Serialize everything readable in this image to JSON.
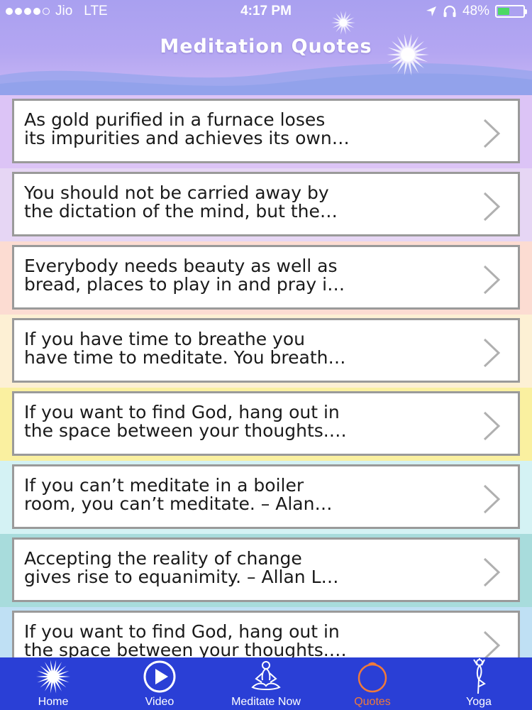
{
  "status_bar": {
    "carrier": "Jio",
    "network": "LTE",
    "time": "4:17 PM",
    "battery": "48%",
    "battery_level": 0.48
  },
  "header": {
    "title": "Meditation Quotes"
  },
  "quotes": [
    {
      "line1": "As gold purified in a furnace loses",
      "line2": "its impurities and achieves its own…",
      "bg": "#dcc4f6"
    },
    {
      "line1": "You should not be carried away by",
      "line2": "the dictation of the mind, but the…",
      "bg": "#e6d6f4"
    },
    {
      "line1": "Everybody needs beauty as well as",
      "line2": "bread, places to play in and pray i…",
      "bg": "#fcdcd2"
    },
    {
      "line1": "If you have time to breathe you",
      "line2": "have time to meditate. You breath…",
      "bg": "#fdf0d4"
    },
    {
      "line1": "If you want to find God, hang out in",
      "line2": "the space between your thoughts.…",
      "bg": "#faf0a0"
    },
    {
      "line1": "If you can’t meditate in a boiler",
      "line2": "room, you can’t meditate. – Alan…",
      "bg": "#d4f2f4"
    },
    {
      "line1": "Accepting the reality of change",
      "line2": "gives rise to equanimity. – Allan L…",
      "bg": "#a8dcdc"
    },
    {
      "line1": "If you want to find God, hang out in",
      "line2": "the space between your thoughts.…",
      "bg": "#bfe0f4"
    }
  ],
  "tabs": [
    {
      "label": "Home",
      "icon": "sun-icon"
    },
    {
      "label": "Video",
      "icon": "play-icon"
    },
    {
      "label": "Meditate Now",
      "icon": "meditation-pose-icon"
    },
    {
      "label": "Quotes",
      "icon": "quotes-circle-icon"
    },
    {
      "label": "Yoga",
      "icon": "yoga-pose-icon"
    }
  ],
  "colors": {
    "header": "#b4a6f2",
    "tabbar": "#2a3fd6",
    "tab_active": "#f07a3a",
    "card_border": "#9a9a9a"
  }
}
